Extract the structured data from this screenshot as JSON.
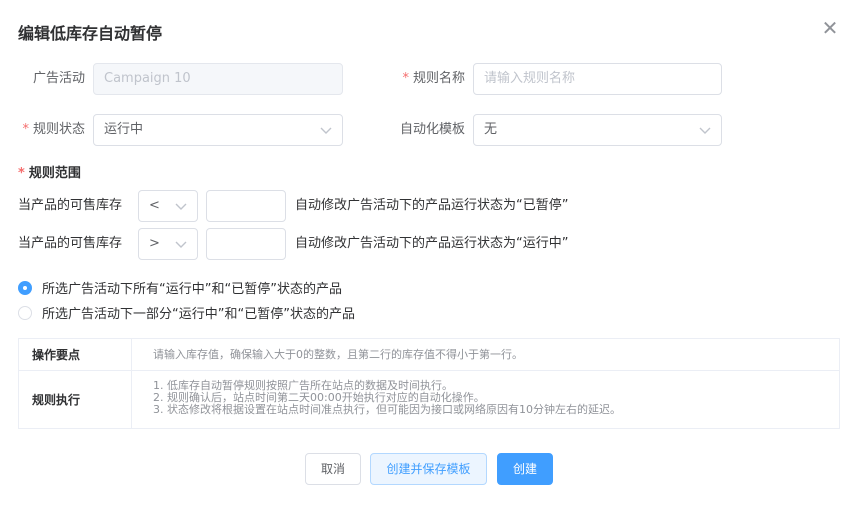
{
  "dialog": {
    "title": "编辑低库存自动暂停"
  },
  "form": {
    "campaign_label": "广告活动",
    "campaign_value": "Campaign 10",
    "rule_name_label": "规则名称",
    "rule_name_placeholder": "请输入规则名称",
    "rule_status_label": "规则状态",
    "rule_status_value": "运行中",
    "template_label": "自动化模板",
    "template_value": "无",
    "required_mark": "*"
  },
  "scope": {
    "title": "规则范围",
    "rows": [
      {
        "prefix": "当产品的可售库存",
        "operator": "<",
        "value": "",
        "suffix": "自动修改广告活动下的产品运行状态为“已暂停”"
      },
      {
        "prefix": "当产品的可售库存",
        "operator": ">",
        "value": "",
        "suffix": "自动修改广告活动下的产品运行状态为“运行中”"
      }
    ],
    "options": [
      {
        "label": "所选广告活动下所有“运行中”和“已暂停”状态的产品",
        "checked": true
      },
      {
        "label": "所选广告活动下一部分“运行中”和“已暂停”状态的产品",
        "checked": false
      }
    ]
  },
  "info": {
    "tips_label": "操作要点",
    "tips_text": "请输入库存值，确保输入大于0的整数，且第二行的库存值不得小于第一行。",
    "exec_label": "规则执行",
    "exec_lines": [
      "1. 低库存自动暂停规则按照广告所在站点的数据及时间执行。",
      "2. 规则确认后，站点时间第二天00:00开始执行对应的自动化操作。",
      "3. 状态修改将根据设置在站点时间准点执行，但可能因为接口或网络原因有10分钟左右的延迟。"
    ]
  },
  "buttons": {
    "cancel": "取消",
    "save_template": "创建并保存模板",
    "create": "创建"
  },
  "colors": {
    "primary": "#409eff",
    "required": "#f56c6c"
  }
}
